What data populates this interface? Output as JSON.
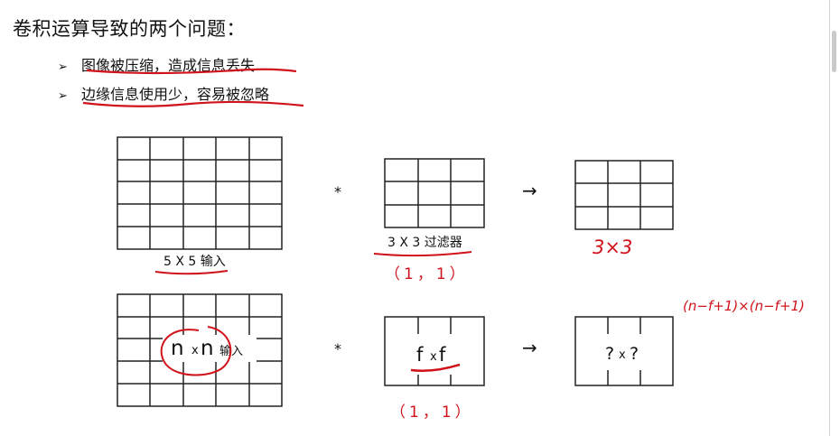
{
  "slide": {
    "title": "卷积运算导致的两个问题：",
    "bullets": [
      "图像被压缩，造成信息丢失",
      "边缘信息使用少，容易被忽略"
    ]
  },
  "top_row": {
    "input_label": "5 X 5 输入",
    "operator": "*",
    "filter_label": "3 X 3 过滤器",
    "filter_note": "（1，1）",
    "arrow": "→",
    "output_label": "3×3"
  },
  "bottom_row": {
    "input_n1": "n",
    "input_x": "x",
    "input_n2": "n",
    "input_suffix": "输入",
    "operator": "*",
    "filter_f1": "f",
    "filter_x": "x",
    "filter_f2": "f",
    "filter_note": "（1，1）",
    "arrow": "→",
    "output_q1": "?",
    "output_x": "x",
    "output_q2": "?",
    "formula": "(n−f+1)×(n−f+1)"
  },
  "colors": {
    "ink": "#111111",
    "annotation": "#d0131b",
    "grid": "#222222"
  }
}
